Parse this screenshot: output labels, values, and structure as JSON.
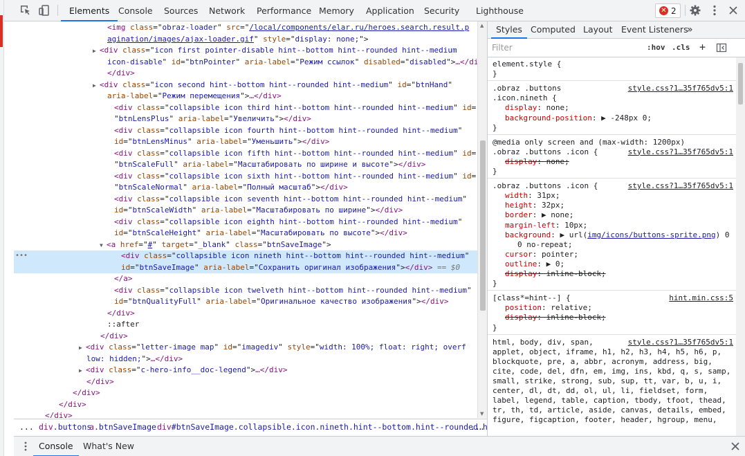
{
  "toolbar": {
    "tabs": [
      "Elements",
      "Console",
      "Sources",
      "Network",
      "Performance",
      "Memory",
      "Application",
      "Security",
      "Lighthouse"
    ],
    "error_count": "2"
  },
  "dom_lines": [
    {
      "indent": 14,
      "parts": [
        [
          "t",
          "<img "
        ],
        [
          "n",
          "class"
        ],
        [
          "p",
          "=\""
        ],
        [
          "v",
          "obraz-loader"
        ],
        [
          "p",
          "\" "
        ],
        [
          "n",
          "src"
        ],
        [
          "p",
          "=\""
        ],
        [
          "l",
          "/local/components/elar.ru/heroes.search.result.p"
        ]
      ]
    },
    {
      "indent": 14,
      "parts": [
        [
          "l",
          "agination/images/ajax-loader.gif"
        ],
        [
          "p",
          "\" "
        ],
        [
          "n",
          "style"
        ],
        [
          "p",
          "=\""
        ],
        [
          "v",
          "display: none;"
        ],
        [
          "p",
          "\">"
        ]
      ]
    },
    {
      "indent": 13,
      "tri": "▶",
      "parts": [
        [
          "t",
          "<div "
        ],
        [
          "n",
          "class"
        ],
        [
          "p",
          "=\""
        ],
        [
          "v",
          "icon first pointer-disable hint--bottom hint--rounded hint--medium"
        ]
      ]
    },
    {
      "indent": 14,
      "parts": [
        [
          "v",
          "icon-disable"
        ],
        [
          "p",
          "\" "
        ],
        [
          "n",
          "id"
        ],
        [
          "p",
          "=\""
        ],
        [
          "v",
          "btnPointer"
        ],
        [
          "p",
          "\" "
        ],
        [
          "n",
          "aria-label"
        ],
        [
          "p",
          "=\""
        ],
        [
          "v",
          "Режим ссылок"
        ],
        [
          "p",
          "\" "
        ],
        [
          "n",
          "disabled"
        ],
        [
          "p",
          "=\""
        ],
        [
          "v",
          "disabled"
        ],
        [
          "p",
          "\">"
        ],
        [
          "t",
          "…"
        ],
        [
          "t",
          "</div>"
        ]
      ]
    },
    {
      "indent": 14,
      "parts": [
        [
          "t",
          "</div>"
        ]
      ]
    },
    {
      "indent": 13,
      "tri": "▶",
      "parts": [
        [
          "t",
          "<div "
        ],
        [
          "n",
          "class"
        ],
        [
          "p",
          "=\""
        ],
        [
          "v",
          "icon second hint--bottom hint--rounded hint--medium"
        ],
        [
          "p",
          "\" "
        ],
        [
          "n",
          "id"
        ],
        [
          "p",
          "=\""
        ],
        [
          "v",
          "btnHand"
        ],
        [
          "p",
          "\""
        ]
      ]
    },
    {
      "indent": 14,
      "parts": [
        [
          "n",
          "aria-label"
        ],
        [
          "p",
          "=\""
        ],
        [
          "v",
          "Режим перемещения"
        ],
        [
          "p",
          "\">"
        ],
        [
          "t",
          "…"
        ],
        [
          "t",
          "</div>"
        ]
      ]
    },
    {
      "indent": 15,
      "parts": [
        [
          "t",
          "<div "
        ],
        [
          "n",
          "class"
        ],
        [
          "p",
          "=\""
        ],
        [
          "v",
          "collapsible icon third hint--bottom hint--rounded hint--medium"
        ],
        [
          "p",
          "\" "
        ],
        [
          "n",
          "id"
        ],
        [
          "p",
          "="
        ]
      ]
    },
    {
      "indent": 15,
      "parts": [
        [
          "p",
          "\""
        ],
        [
          "v",
          "btnLensPlus"
        ],
        [
          "p",
          "\" "
        ],
        [
          "n",
          "aria-label"
        ],
        [
          "p",
          "=\""
        ],
        [
          "v",
          "Увеличить"
        ],
        [
          "p",
          "\">"
        ],
        [
          "t",
          "</div>"
        ]
      ]
    },
    {
      "indent": 15,
      "parts": [
        [
          "t",
          "<div "
        ],
        [
          "n",
          "class"
        ],
        [
          "p",
          "=\""
        ],
        [
          "v",
          "collapsible icon fourth hint--bottom hint--rounded hint--medium"
        ],
        [
          "p",
          "\""
        ]
      ]
    },
    {
      "indent": 15,
      "parts": [
        [
          "n",
          "id"
        ],
        [
          "p",
          "=\""
        ],
        [
          "v",
          "btnLensMinus"
        ],
        [
          "p",
          "\" "
        ],
        [
          "n",
          "aria-label"
        ],
        [
          "p",
          "=\""
        ],
        [
          "v",
          "Уменьшить"
        ],
        [
          "p",
          "\">"
        ],
        [
          "t",
          "</div>"
        ]
      ]
    },
    {
      "indent": 15,
      "parts": [
        [
          "t",
          "<div "
        ],
        [
          "n",
          "class"
        ],
        [
          "p",
          "=\""
        ],
        [
          "v",
          "collapsible icon fifth hint--bottom hint--rounded hint--medium"
        ],
        [
          "p",
          "\" "
        ],
        [
          "n",
          "id"
        ],
        [
          "p",
          "="
        ]
      ]
    },
    {
      "indent": 15,
      "parts": [
        [
          "p",
          "\""
        ],
        [
          "v",
          "btnScaleFull"
        ],
        [
          "p",
          "\" "
        ],
        [
          "n",
          "aria-label"
        ],
        [
          "p",
          "=\""
        ],
        [
          "v",
          "Масштабировать по ширине и высоте"
        ],
        [
          "p",
          "\">"
        ],
        [
          "t",
          "</div>"
        ]
      ]
    },
    {
      "indent": 15,
      "parts": [
        [
          "t",
          "<div "
        ],
        [
          "n",
          "class"
        ],
        [
          "p",
          "=\""
        ],
        [
          "v",
          "collapsible icon sixth hint--bottom hint--rounded hint--medium"
        ],
        [
          "p",
          "\" "
        ],
        [
          "n",
          "id"
        ],
        [
          "p",
          "="
        ]
      ]
    },
    {
      "indent": 15,
      "parts": [
        [
          "p",
          "\""
        ],
        [
          "v",
          "btnScaleNormal"
        ],
        [
          "p",
          "\" "
        ],
        [
          "n",
          "aria-label"
        ],
        [
          "p",
          "=\""
        ],
        [
          "v",
          "Полный масштаб"
        ],
        [
          "p",
          "\">"
        ],
        [
          "t",
          "</div>"
        ]
      ]
    },
    {
      "indent": 15,
      "parts": [
        [
          "t",
          "<div "
        ],
        [
          "n",
          "class"
        ],
        [
          "p",
          "=\""
        ],
        [
          "v",
          "collapsible icon seventh hint--bottom hint--rounded hint--medium"
        ],
        [
          "p",
          "\""
        ]
      ]
    },
    {
      "indent": 15,
      "parts": [
        [
          "n",
          "id"
        ],
        [
          "p",
          "=\""
        ],
        [
          "v",
          "btnScaleWidth"
        ],
        [
          "p",
          "\" "
        ],
        [
          "n",
          "aria-label"
        ],
        [
          "p",
          "=\""
        ],
        [
          "v",
          "Масштабировать по ширине"
        ],
        [
          "p",
          "\">"
        ],
        [
          "t",
          "</div>"
        ]
      ]
    },
    {
      "indent": 15,
      "parts": [
        [
          "t",
          "<div "
        ],
        [
          "n",
          "class"
        ],
        [
          "p",
          "=\""
        ],
        [
          "v",
          "collapsible icon eighth hint--bottom hint--rounded hint--medium"
        ],
        [
          "p",
          "\""
        ]
      ]
    },
    {
      "indent": 15,
      "parts": [
        [
          "n",
          "id"
        ],
        [
          "p",
          "=\""
        ],
        [
          "v",
          "btnScaleHeight"
        ],
        [
          "p",
          "\" "
        ],
        [
          "n",
          "aria-label"
        ],
        [
          "p",
          "=\""
        ],
        [
          "v",
          "Масштабировать по высоте"
        ],
        [
          "p",
          "\">"
        ],
        [
          "t",
          "</div>"
        ]
      ]
    },
    {
      "indent": 14,
      "tri": "▼",
      "parts": [
        [
          "t",
          "<a "
        ],
        [
          "n",
          "href"
        ],
        [
          "p",
          "=\""
        ],
        [
          "l",
          "#"
        ],
        [
          "p",
          "\" "
        ],
        [
          "n",
          "target"
        ],
        [
          "p",
          "=\""
        ],
        [
          "v",
          "_blank"
        ],
        [
          "p",
          "\" "
        ],
        [
          "n",
          "class"
        ],
        [
          "p",
          "=\""
        ],
        [
          "v",
          "btnSaveImage"
        ],
        [
          "p",
          "\">"
        ]
      ]
    },
    {
      "indent": 16,
      "sel": true,
      "parts": [
        [
          "t",
          "<div "
        ],
        [
          "n",
          "class"
        ],
        [
          "p",
          "=\""
        ],
        [
          "v",
          "collapsible icon nineth hint--bottom hint--rounded hint--medium"
        ],
        [
          "p",
          "\""
        ]
      ]
    },
    {
      "indent": 16,
      "sel": true,
      "parts": [
        [
          "n",
          "id"
        ],
        [
          "p",
          "=\""
        ],
        [
          "v",
          "btnSaveImage"
        ],
        [
          "p",
          "\" "
        ],
        [
          "n",
          "aria-label"
        ],
        [
          "p",
          "=\""
        ],
        [
          "v",
          "Сохранить оригинал изображения"
        ],
        [
          "p",
          "\">"
        ],
        [
          "t",
          "</div>"
        ],
        [
          "g",
          " == $0"
        ]
      ]
    },
    {
      "indent": 15,
      "parts": [
        [
          "t",
          "</a>"
        ]
      ]
    },
    {
      "indent": 15,
      "parts": [
        [
          "t",
          "<div "
        ],
        [
          "n",
          "class"
        ],
        [
          "p",
          "=\""
        ],
        [
          "v",
          "collapsible icon twelveth hint--bottom hint--rounded hint--medium"
        ],
        [
          "p",
          "\""
        ]
      ]
    },
    {
      "indent": 15,
      "parts": [
        [
          "n",
          "id"
        ],
        [
          "p",
          "=\""
        ],
        [
          "v",
          "btnQualityFull"
        ],
        [
          "p",
          "\" "
        ],
        [
          "n",
          "aria-label"
        ],
        [
          "p",
          "=\""
        ],
        [
          "v",
          "Оригинальное качество изображения"
        ],
        [
          "p",
          "\">"
        ],
        [
          "t",
          "</div>"
        ]
      ]
    },
    {
      "indent": 14,
      "parts": [
        [
          "t",
          "</div>"
        ]
      ]
    },
    {
      "indent": 14,
      "parts": [
        [
          "p",
          "::after"
        ]
      ]
    },
    {
      "indent": 13,
      "parts": [
        [
          "t",
          "</div>"
        ]
      ]
    },
    {
      "indent": 11,
      "tri": "▶",
      "parts": [
        [
          "t",
          "<div "
        ],
        [
          "n",
          "class"
        ],
        [
          "p",
          "=\""
        ],
        [
          "v",
          "letter-image map"
        ],
        [
          "p",
          "\" "
        ],
        [
          "n",
          "id"
        ],
        [
          "p",
          "=\""
        ],
        [
          "v",
          "imagediv"
        ],
        [
          "p",
          "\" "
        ],
        [
          "n",
          "style"
        ],
        [
          "p",
          "=\""
        ],
        [
          "v",
          "width: 100%; float: right; overf"
        ]
      ]
    },
    {
      "indent": 11,
      "parts": [
        [
          "v",
          "low: hidden;"
        ],
        [
          "p",
          "\">"
        ],
        [
          "t",
          "…"
        ],
        [
          "t",
          "</div>"
        ]
      ]
    },
    {
      "indent": 11,
      "tri": "▶",
      "parts": [
        [
          "t",
          "<div "
        ],
        [
          "n",
          "class"
        ],
        [
          "p",
          "=\""
        ],
        [
          "v",
          "c-hero-info__doc-legend"
        ],
        [
          "p",
          "\">"
        ],
        [
          "t",
          "…"
        ],
        [
          "t",
          "</div>"
        ]
      ]
    },
    {
      "indent": 11,
      "parts": [
        [
          "t",
          "</div>"
        ]
      ]
    },
    {
      "indent": 9,
      "parts": [
        [
          "t",
          "</div>"
        ]
      ]
    },
    {
      "indent": 7,
      "parts": [
        [
          "t",
          "</div>"
        ]
      ]
    },
    {
      "indent": 5,
      "parts": [
        [
          "t",
          "</div>"
        ]
      ]
    }
  ],
  "breadcrumb": {
    "ellipsis": "...",
    "items": [
      {
        "t": "div",
        "c": ".buttons"
      },
      {
        "t": "a",
        "c": ".btnSaveImage"
      },
      {
        "t": "div",
        "c": "#btnSaveImage.collapsible.icon.nineth.hint--bottom.hint--rounded.hint--medium"
      }
    ],
    "more": "..."
  },
  "drawer": {
    "tabs": [
      "Console",
      "What's New"
    ]
  },
  "styles_pane": {
    "tabs": [
      "Styles",
      "Computed",
      "Layout",
      "Event Listeners"
    ],
    "more_tabs": "»",
    "filter_placeholder": "Filter",
    "hov": ":hov",
    "cls": ".cls",
    "plus": "+"
  },
  "style_rules": [
    {
      "type": "sel",
      "text": "element.style {"
    },
    {
      "type": "close",
      "text": "}"
    },
    {
      "type": "sep"
    },
    {
      "type": "sel",
      "text": ".obraz .buttons",
      "src": "style.css?1…35f765dv5:1"
    },
    {
      "type": "sel",
      "text": ".icon.nineth {"
    },
    {
      "type": "prop",
      "name": "display",
      "value": "none;"
    },
    {
      "type": "prop",
      "name": "background-position",
      "value": "▶ -248px 0;"
    },
    {
      "type": "close",
      "text": "}"
    },
    {
      "type": "sep"
    },
    {
      "type": "sel",
      "text": "@media only screen and (max-width: 1200px)"
    },
    {
      "type": "sel",
      "text": ".obraz .buttons .icon {",
      "src": "style.css?1…35f765dv5:1"
    },
    {
      "type": "strike",
      "name": "display",
      "value": "none;"
    },
    {
      "type": "close",
      "text": "}"
    },
    {
      "type": "sep"
    },
    {
      "type": "sel",
      "text": ".obraz .buttons .icon {",
      "src": "style.css?1…35f765dv5:1"
    },
    {
      "type": "prop",
      "name": "width",
      "value": "31px;"
    },
    {
      "type": "prop",
      "name": "height",
      "value": "32px;"
    },
    {
      "type": "prop",
      "name": "border",
      "value": "▶ none;"
    },
    {
      "type": "prop",
      "name": "margin-left",
      "value": "10px;"
    },
    {
      "type": "propurl",
      "name": "background",
      "pre": "▶ url(",
      "link": "img/icons/buttons-sprite.png",
      "post": ") 0"
    },
    {
      "type": "cont",
      "text": "0 no-repeat;"
    },
    {
      "type": "prop",
      "name": "cursor",
      "value": "pointer;"
    },
    {
      "type": "prop",
      "name": "outline",
      "value": "▶ 0;"
    },
    {
      "type": "strike",
      "name": "display",
      "value": "inline-block;"
    },
    {
      "type": "close",
      "text": "}"
    },
    {
      "type": "sep"
    },
    {
      "type": "sel",
      "text": "[class*=hint--] {",
      "src": "hint.min.css:5"
    },
    {
      "type": "prop",
      "name": "position",
      "value": "relative;"
    },
    {
      "type": "strike",
      "name": "display",
      "value": "inline-block;"
    },
    {
      "type": "close",
      "text": "}"
    },
    {
      "type": "sep"
    },
    {
      "type": "sel",
      "text": "html, body, div, span,",
      "src": "style.css?1…35f765dv5:1"
    },
    {
      "type": "sel",
      "text": "applet, object, iframe, h1, h2, h3, h4, h5, h6, p,"
    },
    {
      "type": "sel",
      "text": "blockquote, pre, a, abbr, acronym, address, big,"
    },
    {
      "type": "sel",
      "text": "cite, code, del, dfn, em, img, ins, kbd, q, s, samp,"
    },
    {
      "type": "sel",
      "text": "small, strike, strong, sub, sup, tt, var, b, u, i,"
    },
    {
      "type": "sel",
      "text": "center, dl, dt, dd, ol, ul, li, fieldset, form,"
    },
    {
      "type": "sel",
      "text": "label, legend, table, caption, tbody, tfoot, thead,"
    },
    {
      "type": "sel",
      "text": "tr, th, td, article, aside, canvas, details, embed,"
    },
    {
      "type": "sel",
      "text": "figure, figcaption, footer, header, hgroup, menu,"
    }
  ]
}
